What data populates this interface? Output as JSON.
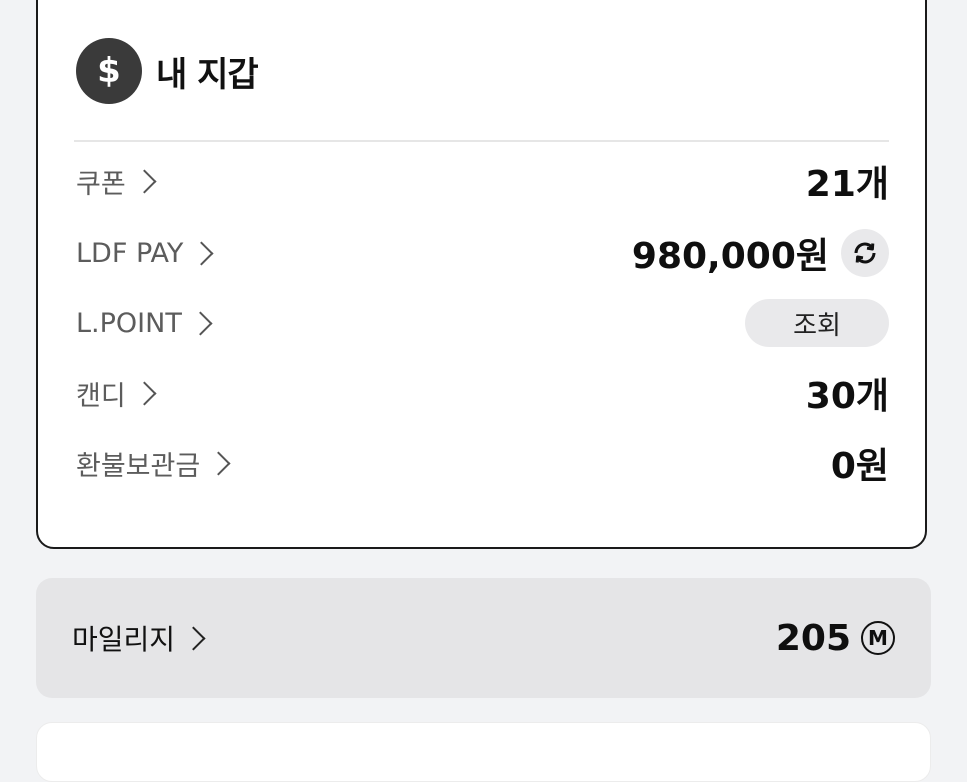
{
  "wallet": {
    "icon_symbol": "$",
    "title": "내 지갑",
    "rows": [
      {
        "label": "쿠폰",
        "value": "21개"
      },
      {
        "label": "LDF PAY",
        "value": "980,000원"
      },
      {
        "label": "L.POINT",
        "button_label": "조회"
      },
      {
        "label": "캔디",
        "value": "30개"
      },
      {
        "label": "환불보관금",
        "value": "0원"
      }
    ]
  },
  "mileage": {
    "label": "마일리지",
    "value": "205",
    "unit_badge": "M"
  },
  "colors": {
    "coin_bg": "#3a3a3a",
    "mileage_bg": "#e5e5e7",
    "page_bg": "#f2f3f5"
  }
}
